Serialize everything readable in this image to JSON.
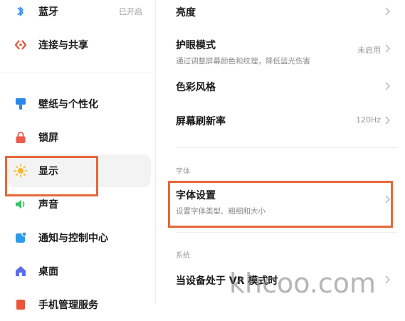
{
  "sidebar": {
    "items": [
      {
        "label": "蓝牙",
        "status": "已开启",
        "icon": "bluetooth-icon"
      },
      {
        "label": "连接与共享",
        "icon": "share-icon"
      },
      {
        "label": "壁纸与个性化",
        "icon": "wallpaper-icon"
      },
      {
        "label": "锁屏",
        "icon": "lock-icon"
      },
      {
        "label": "显示",
        "icon": "sun-icon"
      },
      {
        "label": "声音",
        "icon": "speaker-icon"
      },
      {
        "label": "通知与控制中心",
        "icon": "notification-icon"
      },
      {
        "label": "桌面",
        "icon": "home-icon"
      },
      {
        "label": "手机管理服务",
        "icon": "manage-icon"
      }
    ]
  },
  "main": {
    "rows": [
      {
        "title": "亮度"
      },
      {
        "title": "护眼模式",
        "subtitle": "通过调整屏幕颜色和纹理，降低蓝光伤害",
        "value": "未启用"
      },
      {
        "title": "色彩风格"
      },
      {
        "title": "屏幕刷新率",
        "value": "120Hz"
      }
    ],
    "font_section": {
      "label": "字体",
      "row": {
        "title": "字体设置",
        "subtitle": "设置字体类型、粗细和大小"
      }
    },
    "system_section": {
      "label": "系统",
      "row": {
        "title": "当设备处于 VR 模式时"
      }
    }
  },
  "watermark": "khcoo.com",
  "colors": {
    "highlight": "#e8673a",
    "bluetooth": "#3c8ee8",
    "share": "#e8553a",
    "wallpaper": "#2a86e8",
    "lock": "#ee5a4a",
    "sun": "#f5b82e",
    "speaker": "#3cc46a",
    "notification": "#2a9be8",
    "home": "#5a6ee8"
  }
}
